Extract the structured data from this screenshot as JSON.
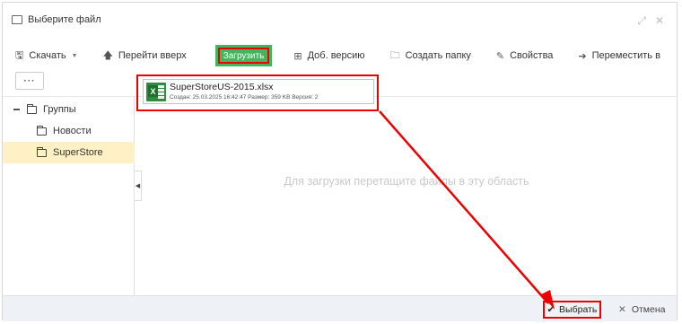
{
  "dialog": {
    "title": "Выберите файл",
    "window_icons": [
      "expand-icon",
      "close-icon"
    ]
  },
  "toolbar": {
    "download_label": "Скачать",
    "up_label": "Перейти вверх",
    "upload_label": "Загрузить",
    "add_version_label": "Доб. версию",
    "create_folder_label": "Создать папку",
    "properties_label": "Свойства",
    "move_label": "Переместить в",
    "more_label": "···"
  },
  "tree": {
    "root_label": "Группы",
    "items": [
      {
        "label": "Новости"
      },
      {
        "label": "SuperStore",
        "selected": true
      }
    ]
  },
  "main": {
    "drop_hint": "Для загрузки перетащите файлы в эту область",
    "file": {
      "name": "SuperStoreUS-2015.xlsx",
      "meta": "Создан: 25.03.2025 16:42:47 Размер: 359 KB Версия: 2"
    }
  },
  "footer": {
    "select_label": "Выбрать",
    "cancel_label": "Отмена"
  },
  "colors": {
    "upload_green": "#43b55c",
    "highlight_red": "#e00000",
    "selected_row": "#fdf1c5",
    "footer_bg": "#eef1f6"
  }
}
